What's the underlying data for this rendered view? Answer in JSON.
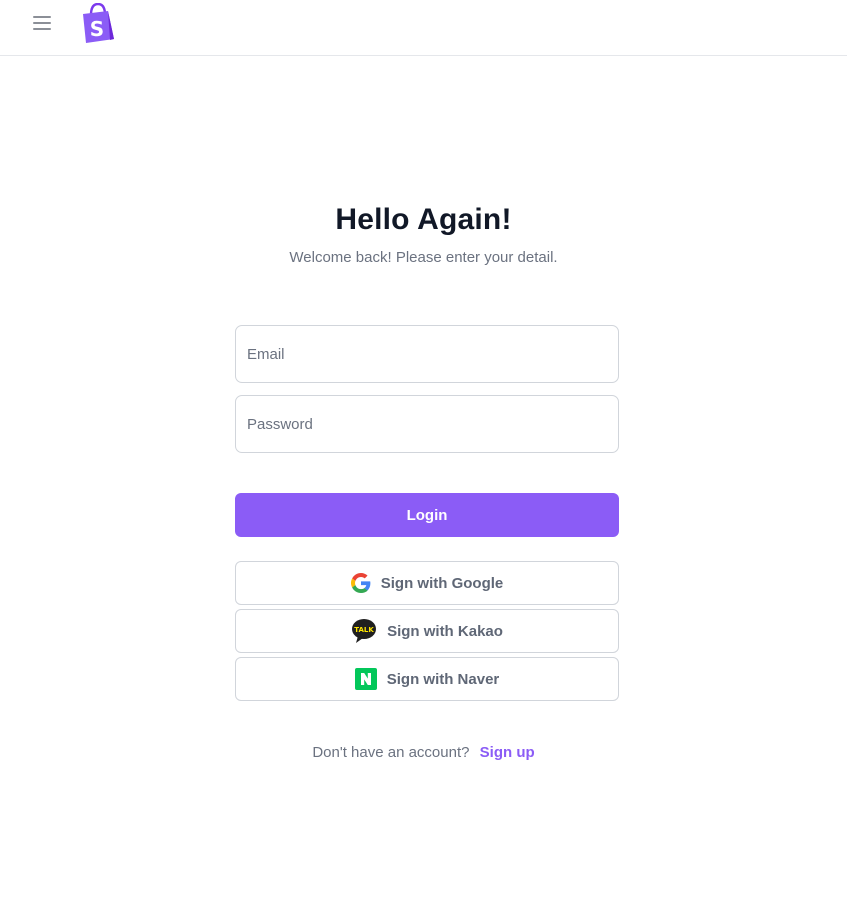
{
  "header": {
    "menu_icon": "hamburger-menu-icon",
    "logo_icon": "shopping-bag-logo-icon",
    "brand_color": "#8b5cf6"
  },
  "main": {
    "title": "Hello Again!",
    "subtitle": "Welcome back! Please enter your detail.",
    "email": {
      "placeholder": "Email",
      "value": ""
    },
    "password": {
      "placeholder": "Password",
      "value": ""
    },
    "login_label": "Login",
    "social": [
      {
        "label": "Sign with Google",
        "icon": "google-icon"
      },
      {
        "label": "Sign with Kakao",
        "icon": "kakao-talk-icon"
      },
      {
        "label": "Sign with Naver",
        "icon": "naver-icon"
      }
    ],
    "kakao_icon_text": "TALK",
    "signup": {
      "prompt": "Don't have an account?",
      "link": "Sign up"
    }
  }
}
